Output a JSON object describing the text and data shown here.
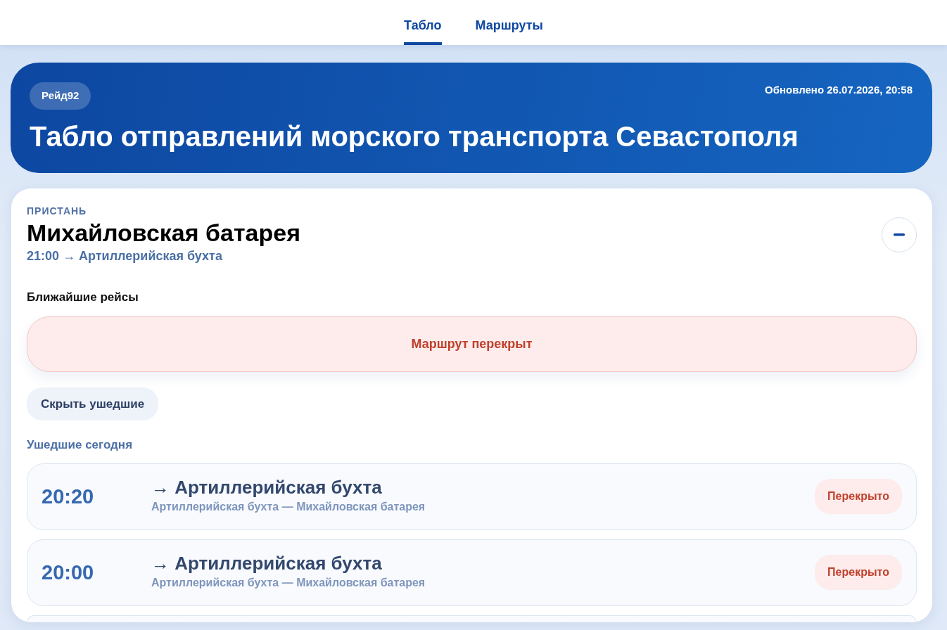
{
  "tabs": [
    {
      "label": "Табло",
      "selected": true
    },
    {
      "label": "Маршруты",
      "selected": false
    }
  ],
  "header": {
    "badge": "Рейд92",
    "updated": "Обновлено 26.07.2026, 20:58",
    "title": "Табло отправлений морского транспорта Севастополя"
  },
  "pier": {
    "eyebrow": "ПРИСТАНЬ",
    "name": "Михайловская батарея",
    "next": "21:00 → Артиллерийская бухта",
    "expanded": true,
    "upcoming_heading": "Ближайшие рейсы",
    "closed_notice": "Маршрут перекрыт",
    "toggle_button": "Скрыть ушедшие",
    "departed_heading": "Ушедшие сегодня",
    "departures": [
      {
        "time": "20:20",
        "destination": "→ Артиллерийская бухта",
        "route": "Артиллерийская бухта — Михайловская батарея",
        "status": "Перекрыто",
        "kind": "closed"
      },
      {
        "time": "20:00",
        "destination": "→ Артиллерийская бухта",
        "route": "Артиллерийская бухта — Михайловская батарея",
        "status": "Перекрыто",
        "kind": "closed"
      },
      {
        "kind": "empty"
      }
    ]
  }
}
